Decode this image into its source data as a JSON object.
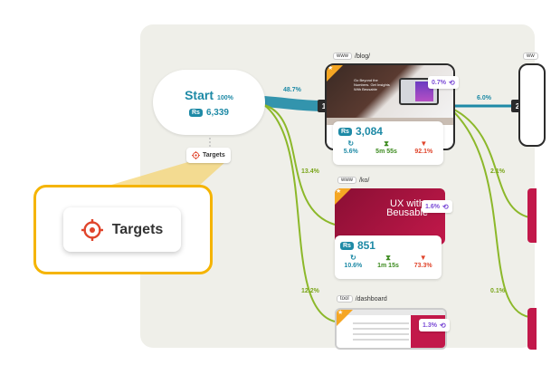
{
  "start": {
    "label": "Start",
    "percent": "100%",
    "badge": "Rs",
    "count": "6,339"
  },
  "targets": {
    "label": "Targets"
  },
  "flows": {
    "main_percent": "48.7%",
    "ko_percent": "13.4%",
    "dashboard_percent": "12.2%",
    "blog_next_percent": "6.0%",
    "blog_ko_percent": "2.1%",
    "blog_dash_percent": "0.1%"
  },
  "steps": {
    "first": "1",
    "second": "2"
  },
  "pages": [
    {
      "tag": "www",
      "path": "/blog/",
      "rate": "0.7%",
      "badge": "Rs",
      "visitors": "3,084",
      "stats": {
        "return": "5.6%",
        "time": "5m 55s",
        "bounce": "92.1%"
      },
      "hero_text": "Go Beyond the Numbers. Get Insights With Beusable"
    },
    {
      "tag": "www",
      "path": "/ko/",
      "rate": "1.6%",
      "badge": "Rs",
      "visitors": "851",
      "stats": {
        "return": "10.6%",
        "time": "1m 15s",
        "bounce": "73.3%"
      },
      "hero_text": "UX with Beusable"
    },
    {
      "tag": "tool",
      "path": "/dashboard",
      "rate": "1.3%"
    }
  ],
  "right_tag": "ww",
  "colors": {
    "accent": "#1e8aa6",
    "flow_green": "#8cb82a",
    "highlight": "#f5b400",
    "target_red": "#e0452c",
    "rate_purple": "#7b4bd6"
  },
  "icons": [
    "target-icon",
    "return-icon",
    "hourglass-icon",
    "bounce-icon",
    "undo-icon",
    "star-icon"
  ]
}
